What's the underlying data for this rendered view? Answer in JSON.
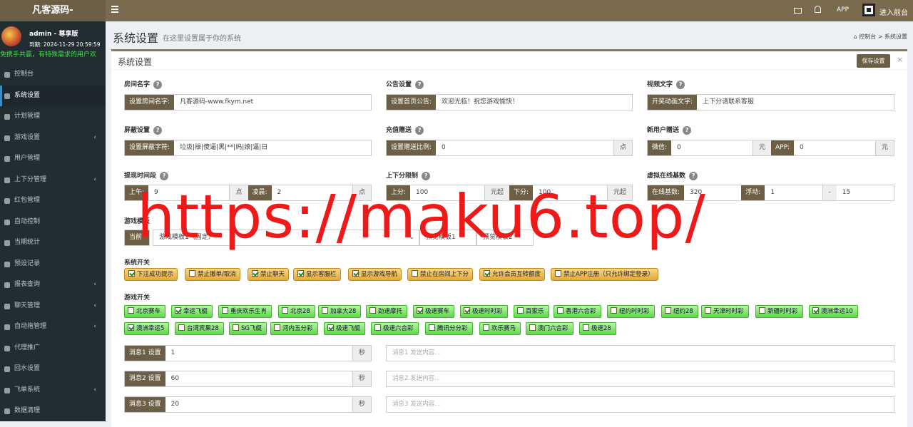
{
  "brand": "凡客源码-",
  "topbar": {
    "app": "APP",
    "front": "进入前台"
  },
  "user": {
    "name": "admin - 尊享版",
    "expire": "到期: 2024-11-29 20:59:59",
    "marquee": "免携手共赢，有特殊需求的用户欢"
  },
  "menu": [
    {
      "label": "控制台",
      "caret": ""
    },
    {
      "label": "系统设置",
      "caret": ""
    },
    {
      "label": "计划管理",
      "caret": ""
    },
    {
      "label": "游戏设置",
      "caret": "‹"
    },
    {
      "label": "用户管理",
      "caret": ""
    },
    {
      "label": "上下分管理",
      "caret": "‹"
    },
    {
      "label": "红包管理",
      "caret": ""
    },
    {
      "label": "自动控制",
      "caret": ""
    },
    {
      "label": "当期统计",
      "caret": ""
    },
    {
      "label": "预设记录",
      "caret": ""
    },
    {
      "label": "报表查询",
      "caret": "‹"
    },
    {
      "label": "聊天管理",
      "caret": "‹"
    },
    {
      "label": "自动拖管理",
      "caret": "‹"
    },
    {
      "label": "代理推广",
      "caret": ""
    },
    {
      "label": "回水设置",
      "caret": ""
    },
    {
      "label": "飞单系统",
      "caret": "‹"
    },
    {
      "label": "数据清理",
      "caret": ""
    }
  ],
  "page": {
    "title": "系统设置",
    "subtitle": "在这里设置属于你的系统",
    "crumb_home": "控制台",
    "crumb_sep": ">",
    "crumb_current": "系统设置"
  },
  "box": {
    "title": "系统设置",
    "save": "保存设置",
    "close": "×"
  },
  "fields": {
    "room": {
      "label": "房间名字",
      "addon": "设置房间名字:",
      "value": "凡客源码-www.fkym.net"
    },
    "notice": {
      "label": "公告设置",
      "addon": "设置首页公告:",
      "value": "欢迎光临！祝您游戏愉快！"
    },
    "video": {
      "label": "视频文字",
      "addon": "开奖动画文字:",
      "value": "上下分请联系客服"
    },
    "block": {
      "label": "屏蔽设置",
      "addon": "设置屏蔽字符:",
      "value": "垃圾|操|傻逼|黑|**|妈|娘|逼|日"
    },
    "recharge": {
      "label": "充值赠送",
      "addon": "设置赠送比例:",
      "value": "0",
      "suffix": "点"
    },
    "newuser": {
      "label": "新用户赠送",
      "addon1": "微信:",
      "value1": "0",
      "suffix1": "元",
      "addon2": "APP:",
      "value2": "0",
      "suffix2": "元"
    },
    "withdraw": {
      "label": "提现时间段",
      "addon1": "上午:",
      "value1": "9",
      "suffix1": "点",
      "addon2": "凌晨:",
      "value2": "2",
      "suffix2": "点"
    },
    "limit": {
      "label": "上下分限制",
      "addon1": "上分:",
      "value1": "100",
      "suffix1": "元起",
      "addon2": "下分:",
      "value2": "100",
      "suffix2": "元起"
    },
    "online": {
      "label": "虚拟在线基数",
      "addon1": "在线基数:",
      "value1": "320",
      "addon2": "浮动:",
      "value2": "1",
      "sep": "-",
      "value3": "15"
    },
    "template": {
      "label": "游戏模板",
      "addon": "当前",
      "select": "游戏模板1（固定）",
      "preview1": "预览模板1",
      "preview2": "预览模板2"
    }
  },
  "switches_label": "系统开关",
  "switches": [
    {
      "label": "下注成功提示",
      "on": true
    },
    {
      "label": "禁止撤单/取消",
      "on": false
    },
    {
      "label": "禁止聊天",
      "on": true
    },
    {
      "label": "显示客服栏",
      "on": true
    },
    {
      "label": "显示游戏导航",
      "on": true
    },
    {
      "label": "禁止在房间上下分",
      "on": false
    },
    {
      "label": "允许会员互转额度",
      "on": true
    },
    {
      "label": "禁止APP注册（只允许绑定登录）",
      "on": false
    }
  ],
  "games_label": "游戏开关",
  "games": [
    {
      "label": "北京赛车",
      "on": false
    },
    {
      "label": "幸运飞艇",
      "on": true
    },
    {
      "label": "重庆欢乐生肖",
      "on": false
    },
    {
      "label": "北京28",
      "on": false
    },
    {
      "label": "加拿大28",
      "on": false
    },
    {
      "label": "劲速摩托",
      "on": false
    },
    {
      "label": "极速赛车",
      "on": true
    },
    {
      "label": "极速时时彩",
      "on": true
    },
    {
      "label": "百家乐",
      "on": false
    },
    {
      "label": "香港六合彩",
      "on": false
    },
    {
      "label": "纽约时时彩",
      "on": false
    },
    {
      "label": "纽约28",
      "on": false
    },
    {
      "label": "天津时时彩",
      "on": false
    },
    {
      "label": "新疆时时彩",
      "on": false
    },
    {
      "label": "澳洲幸运10",
      "on": true
    },
    {
      "label": "澳洲幸运5",
      "on": true
    },
    {
      "label": "台湾宾果28",
      "on": false
    },
    {
      "label": "SG飞艇",
      "on": false
    },
    {
      "label": "河内五分彩",
      "on": false
    },
    {
      "label": "极速飞艇",
      "on": true
    },
    {
      "label": "极速六合彩",
      "on": false
    },
    {
      "label": "腾讯分分彩",
      "on": false
    },
    {
      "label": "欢乐赛马",
      "on": false
    },
    {
      "label": "澳门六合彩",
      "on": false
    },
    {
      "label": "极速28",
      "on": false
    }
  ],
  "messages": [
    {
      "label": "消息1 设置",
      "value": "1",
      "suffix": "秒",
      "placeholder": "消息1 发送内容..."
    },
    {
      "label": "消息2 设置",
      "value": "60",
      "suffix": "秒",
      "placeholder": "消息2 发送内容..."
    },
    {
      "label": "消息3 设置",
      "value": "20",
      "suffix": "秒",
      "placeholder": "消息3 发送内容..."
    }
  ],
  "watermark": "https://maku6.top/",
  "colors": {
    "topbar": "#7a6b4f",
    "addon": "#6d5f45",
    "sidebar": "#222d32",
    "switch": "#e3a93a",
    "game": "#5ed94a",
    "watermark": "#ee1a1a"
  }
}
